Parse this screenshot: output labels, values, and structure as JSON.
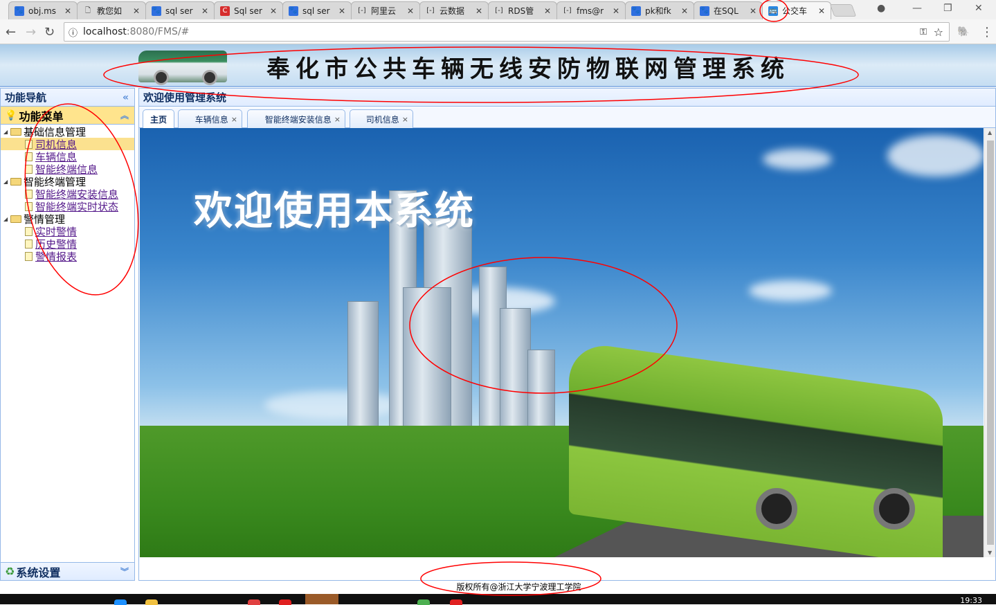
{
  "browser": {
    "tabs": [
      {
        "title": "obj.ms",
        "icon": "baidu-paw-icon"
      },
      {
        "title": "教您如",
        "icon": "document-icon"
      },
      {
        "title": "sql ser",
        "icon": "baidu-paw-icon"
      },
      {
        "title": "Sql ser",
        "icon": "csdn-icon"
      },
      {
        "title": "sql ser",
        "icon": "baidu-paw-icon"
      },
      {
        "title": "阿里云",
        "icon": "aliyun-icon"
      },
      {
        "title": "云数据",
        "icon": "aliyun-icon"
      },
      {
        "title": "RDS管",
        "icon": "aliyun-icon"
      },
      {
        "title": "fms@r",
        "icon": "aliyun-icon"
      },
      {
        "title": "pk和fk",
        "icon": "baidu-paw-icon"
      },
      {
        "title": "在SQL",
        "icon": "baidu-paw-icon"
      },
      {
        "title": "公交车",
        "icon": "bus-icon",
        "active": true
      }
    ],
    "url_host": "localhost",
    "url_rest": ":8080/FMS/#"
  },
  "banner": {
    "title": "奉化市公共车辆无线安防物联网管理系统"
  },
  "left_panel": {
    "title": "功能导航",
    "menu_title": "功能菜单",
    "tree": [
      {
        "label": "基础信息管理",
        "children": [
          {
            "label": "司机信息",
            "selected": true
          },
          {
            "label": "车辆信息"
          },
          {
            "label": "智能终端信息"
          }
        ]
      },
      {
        "label": "智能终端管理",
        "children": [
          {
            "label": "智能终端安装信息"
          },
          {
            "label": "智能终端实时状态"
          }
        ]
      },
      {
        "label": "警情管理",
        "children": [
          {
            "label": "实时警情"
          },
          {
            "label": "历史警情"
          },
          {
            "label": "警情报表"
          }
        ]
      }
    ],
    "settings_title": "系统设置"
  },
  "main_panel": {
    "title": "欢迎使用管理系统",
    "tabs": [
      {
        "label": "主页"
      },
      {
        "label": "车辆信息",
        "close": "×"
      },
      {
        "label": "智能终端安装信息",
        "close": "×"
      },
      {
        "label": "司机信息",
        "close": "×"
      }
    ],
    "welcome_text": "欢迎使用本系统"
  },
  "footer": {
    "copyright": "版权所有@浙江大学宁波理工学院"
  },
  "taskbar": {
    "clock": "19:33"
  },
  "colors": {
    "panel_border": "#95b8e7",
    "selected": "#fbe18f",
    "link": "#551a8b",
    "annotation": "#ff0000"
  }
}
